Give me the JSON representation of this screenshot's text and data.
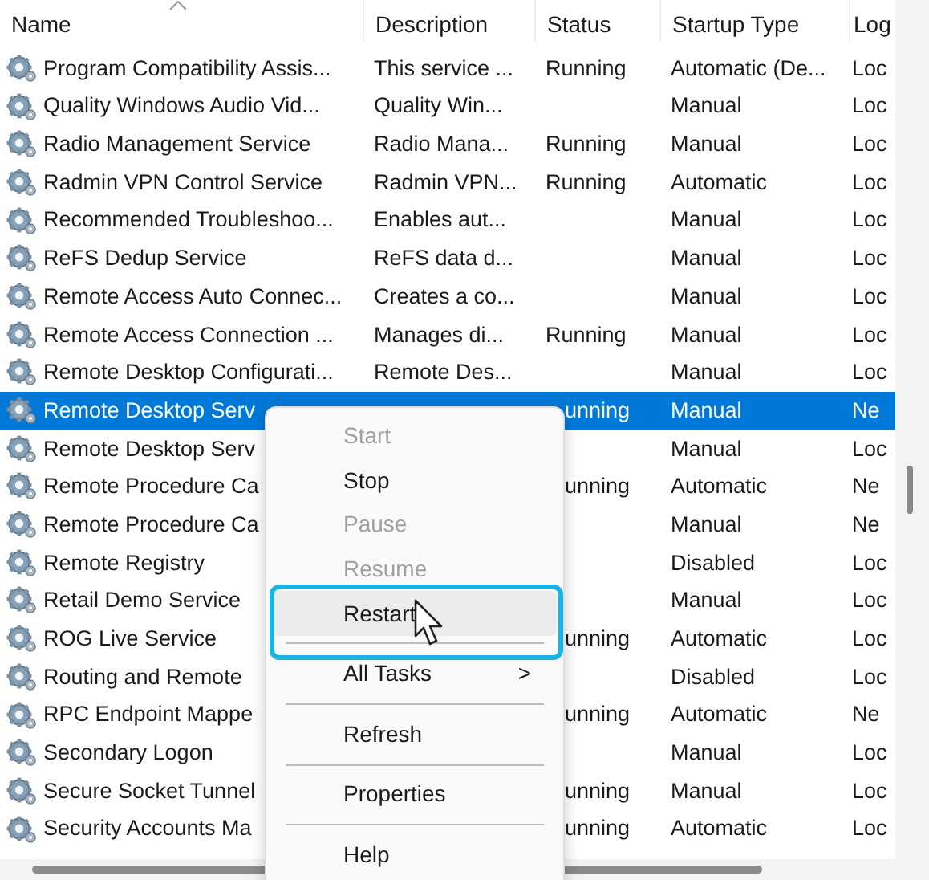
{
  "table": {
    "columns": [
      {
        "label": "Name",
        "sorted": true
      },
      {
        "label": "Description",
        "sorted": false
      },
      {
        "label": "Status",
        "sorted": false
      },
      {
        "label": "Startup Type",
        "sorted": false
      },
      {
        "label": "Log",
        "sorted": false
      }
    ],
    "rows": [
      {
        "name": "Program Compatibility Assis...",
        "description": "This service ...",
        "status": "Running",
        "startup": "Automatic (De...",
        "logon": "Loc",
        "selected": false
      },
      {
        "name": "Quality Windows Audio Vid...",
        "description": "Quality Win...",
        "status": "",
        "startup": "Manual",
        "logon": "Loc",
        "selected": false
      },
      {
        "name": "Radio Management Service",
        "description": "Radio Mana...",
        "status": "Running",
        "startup": "Manual",
        "logon": "Loc",
        "selected": false
      },
      {
        "name": "Radmin VPN Control Service",
        "description": "Radmin VPN...",
        "status": "Running",
        "startup": "Automatic",
        "logon": "Loc",
        "selected": false
      },
      {
        "name": "Recommended Troubleshoo...",
        "description": "Enables aut...",
        "status": "",
        "startup": "Manual",
        "logon": "Loc",
        "selected": false
      },
      {
        "name": "ReFS Dedup Service",
        "description": "ReFS data d...",
        "status": "",
        "startup": "Manual",
        "logon": "Loc",
        "selected": false
      },
      {
        "name": "Remote Access Auto Connec...",
        "description": "Creates a co...",
        "status": "",
        "startup": "Manual",
        "logon": "Loc",
        "selected": false
      },
      {
        "name": "Remote Access Connection ...",
        "description": "Manages di...",
        "status": "Running",
        "startup": "Manual",
        "logon": "Loc",
        "selected": false
      },
      {
        "name": "Remote Desktop Configurati...",
        "description": "Remote Des...",
        "status": "",
        "startup": "Manual",
        "logon": "Loc",
        "selected": false
      },
      {
        "name": "Remote Desktop Serv",
        "status": "unning",
        "startup": "Manual",
        "logon": "Ne",
        "selected": true
      },
      {
        "name": "Remote Desktop Serv",
        "status": "",
        "startup": "Manual",
        "logon": "Loc",
        "selected": false
      },
      {
        "name": "Remote Procedure Ca",
        "status": "unning",
        "startup": "Automatic",
        "logon": "Ne",
        "selected": false
      },
      {
        "name": "Remote Procedure Ca",
        "status": "",
        "startup": "Manual",
        "logon": "Ne",
        "selected": false
      },
      {
        "name": "Remote Registry",
        "status": "",
        "startup": "Disabled",
        "logon": "Loc",
        "selected": false
      },
      {
        "name": "Retail Demo Service",
        "status": "",
        "startup": "Manual",
        "logon": "Loc",
        "selected": false
      },
      {
        "name": "ROG Live Service",
        "status": "unning",
        "startup": "Automatic",
        "logon": "Loc",
        "selected": false
      },
      {
        "name": "Routing and Remote",
        "status": "",
        "startup": "Disabled",
        "logon": "Loc",
        "selected": false
      },
      {
        "name": "RPC Endpoint Mappe",
        "status": "unning",
        "startup": "Automatic",
        "logon": "Ne",
        "selected": false
      },
      {
        "name": "Secondary Logon",
        "status": "",
        "startup": "Manual",
        "logon": "Loc",
        "selected": false
      },
      {
        "name": "Secure Socket Tunnel",
        "status": "unning",
        "startup": "Manual",
        "logon": "Loc",
        "selected": false
      },
      {
        "name": "Security Accounts Ma",
        "status": "unning",
        "startup": "Automatic",
        "logon": "Loc",
        "selected": false
      }
    ]
  },
  "context_menu": {
    "items": [
      {
        "kind": "item",
        "label": "Start",
        "disabled": true,
        "hovered": false
      },
      {
        "kind": "item",
        "label": "Stop",
        "disabled": false,
        "hovered": false
      },
      {
        "kind": "item",
        "label": "Pause",
        "disabled": true,
        "hovered": false
      },
      {
        "kind": "item",
        "label": "Resume",
        "disabled": true,
        "hovered": false
      },
      {
        "kind": "item",
        "label": "Restart",
        "disabled": false,
        "hovered": true
      },
      {
        "kind": "separator"
      },
      {
        "kind": "submenu",
        "label": "All Tasks",
        "submenu_arrow": ">",
        "disabled": false,
        "hovered": false
      },
      {
        "kind": "separator"
      },
      {
        "kind": "item",
        "label": "Refresh",
        "disabled": false,
        "hovered": false
      },
      {
        "kind": "separator"
      },
      {
        "kind": "item",
        "label": "Properties",
        "disabled": false,
        "hovered": false
      },
      {
        "kind": "separator"
      },
      {
        "kind": "item",
        "label": "Help",
        "disabled": false,
        "hovered": false
      }
    ]
  }
}
